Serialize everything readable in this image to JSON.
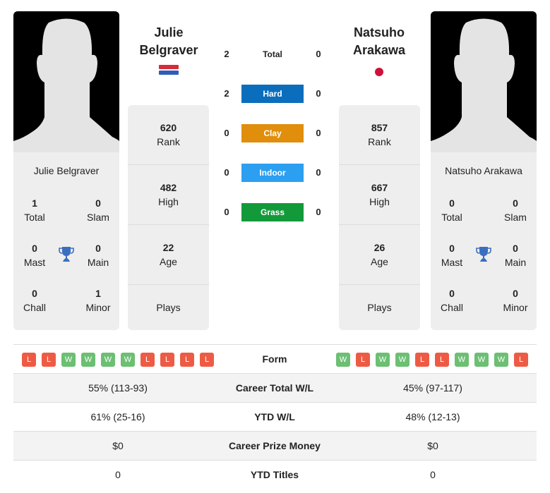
{
  "players": {
    "left": {
      "name": "Julie Belgraver",
      "name_line1": "Julie",
      "name_line2": "Belgraver",
      "country_flag": "netherlands-flag-icon",
      "titles": {
        "total": {
          "value": "1",
          "label": "Total"
        },
        "slam": {
          "value": "0",
          "label": "Slam"
        },
        "mast": {
          "value": "0",
          "label": "Mast"
        },
        "main": {
          "value": "0",
          "label": "Main"
        },
        "chall": {
          "value": "0",
          "label": "Chall"
        },
        "minor": {
          "value": "1",
          "label": "Minor"
        }
      },
      "stats": {
        "rank": {
          "value": "620",
          "label": "Rank"
        },
        "high": {
          "value": "482",
          "label": "High"
        },
        "age": {
          "value": "22",
          "label": "Age"
        },
        "plays": {
          "value": "",
          "label": "Plays"
        }
      },
      "form": [
        "L",
        "L",
        "W",
        "W",
        "W",
        "W",
        "L",
        "L",
        "L",
        "L"
      ]
    },
    "right": {
      "name": "Natsuho Arakawa",
      "name_line1": "Natsuho",
      "name_line2": "Arakawa",
      "country_flag": "japan-flag-icon",
      "titles": {
        "total": {
          "value": "0",
          "label": "Total"
        },
        "slam": {
          "value": "0",
          "label": "Slam"
        },
        "mast": {
          "value": "0",
          "label": "Mast"
        },
        "main": {
          "value": "0",
          "label": "Main"
        },
        "chall": {
          "value": "0",
          "label": "Chall"
        },
        "minor": {
          "value": "0",
          "label": "Minor"
        }
      },
      "stats": {
        "rank": {
          "value": "857",
          "label": "Rank"
        },
        "high": {
          "value": "667",
          "label": "High"
        },
        "age": {
          "value": "26",
          "label": "Age"
        },
        "plays": {
          "value": "",
          "label": "Plays"
        }
      },
      "form": [
        "W",
        "L",
        "W",
        "W",
        "L",
        "L",
        "W",
        "W",
        "W",
        "L"
      ]
    }
  },
  "h2h": {
    "total": {
      "label": "Total",
      "left": "2",
      "right": "0"
    },
    "surfaces": [
      {
        "label": "Hard",
        "left": "2",
        "right": "0",
        "color": "#0a6ebd"
      },
      {
        "label": "Clay",
        "left": "0",
        "right": "0",
        "color": "#e08e0b"
      },
      {
        "label": "Indoor",
        "left": "0",
        "right": "0",
        "color": "#2c9ff0"
      },
      {
        "label": "Grass",
        "left": "0",
        "right": "0",
        "color": "#129a3a"
      }
    ]
  },
  "comparison": {
    "form_label": "Form",
    "rows": [
      {
        "label": "Career Total W/L",
        "left": "55% (113-93)",
        "right": "45% (97-117)"
      },
      {
        "label": "YTD W/L",
        "left": "61% (25-16)",
        "right": "48% (12-13)"
      },
      {
        "label": "Career Prize Money",
        "left": "$0",
        "right": "$0"
      },
      {
        "label": "YTD Titles",
        "left": "0",
        "right": "0"
      }
    ]
  },
  "colors": {
    "win": "#6cbf73",
    "loss": "#ee5b45",
    "trophy": "#3a6fc0"
  }
}
